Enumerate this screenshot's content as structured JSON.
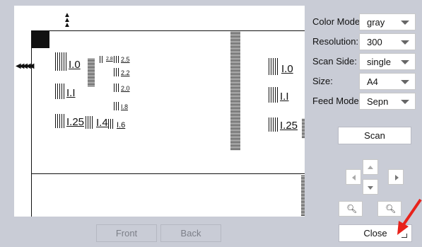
{
  "settings": {
    "color_mode": {
      "label": "Color Mode:",
      "value": "gray"
    },
    "resolution": {
      "label": "Resolution:",
      "value": "300"
    },
    "scan_side": {
      "label": "Scan Side:",
      "value": "single"
    },
    "size": {
      "label": "Size:",
      "value": "A4"
    },
    "feed_mode": {
      "label": "Feed Mode:",
      "value": "Sepn"
    }
  },
  "buttons": {
    "scan": "Scan",
    "front": "Front",
    "back": "Back",
    "close": "Close"
  },
  "preview_targets": {
    "t10": "I.0",
    "t11": "I.I",
    "t125": "I.25",
    "t14": "I.4",
    "t16": "I.6",
    "t18": "I.8",
    "t20": "2.0",
    "t22": "2.2",
    "t25": "2.5",
    "t28": "2.8",
    "r10": "I.0",
    "r11": "I.I",
    "r125": "I.25"
  },
  "icons": {
    "pan_up": "chevron-up-icon",
    "pan_down": "chevron-down-icon",
    "pan_left": "chevron-left-icon",
    "pan_right": "chevron-right-icon",
    "zoom_out": "zoom-out-icon",
    "zoom_in": "zoom-in-icon"
  },
  "colors": {
    "background": "#c9ccd6",
    "pointer_arrow": "#e8221b"
  }
}
